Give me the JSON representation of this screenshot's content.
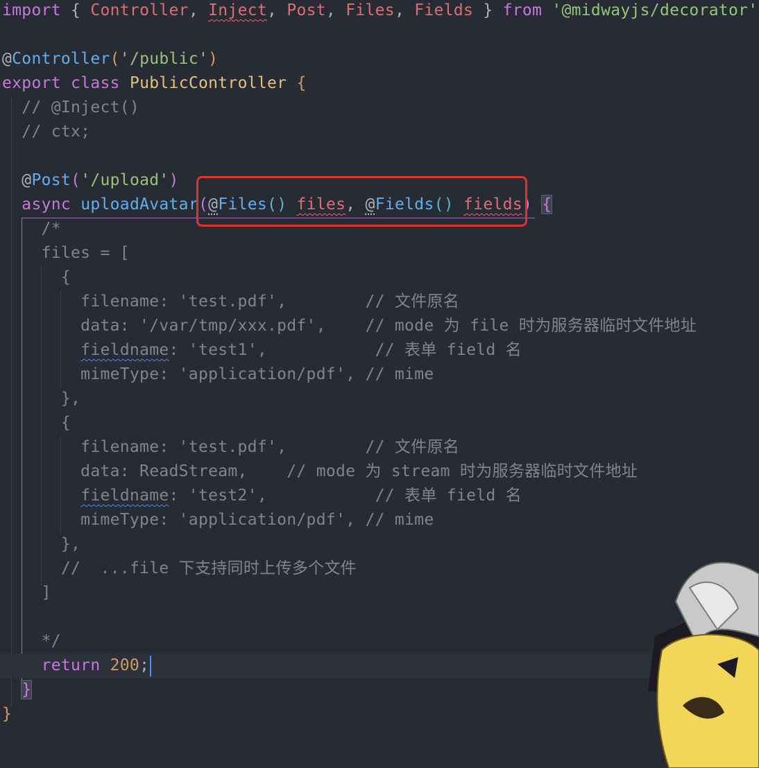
{
  "editor": {
    "lines": [
      {
        "tokens": [
          {
            "t": "import",
            "c": "kw"
          },
          {
            "t": " { ",
            "c": "plain"
          },
          {
            "t": "Controller",
            "c": "imp"
          },
          {
            "t": ", ",
            "c": "plain"
          },
          {
            "t": "Inject",
            "c": "imp squig"
          },
          {
            "t": ", ",
            "c": "plain"
          },
          {
            "t": "Post",
            "c": "imp"
          },
          {
            "t": ", ",
            "c": "plain"
          },
          {
            "t": "Files",
            "c": "imp"
          },
          {
            "t": ", ",
            "c": "plain"
          },
          {
            "t": "Fields",
            "c": "imp"
          },
          {
            "t": " } ",
            "c": "plain"
          },
          {
            "t": "from",
            "c": "kw"
          },
          {
            "t": " ",
            "c": "plain"
          },
          {
            "t": "'@midwayjs/decorator'",
            "c": "str"
          },
          {
            "t": ";",
            "c": "plain"
          }
        ]
      },
      {
        "tokens": []
      },
      {
        "tokens": [
          {
            "t": "@",
            "c": "plain"
          },
          {
            "t": "Controller",
            "c": "fn"
          },
          {
            "t": "(",
            "c": "br2"
          },
          {
            "t": "'/public'",
            "c": "str"
          },
          {
            "t": ")",
            "c": "br2"
          }
        ]
      },
      {
        "tokens": [
          {
            "t": "export",
            "c": "kw"
          },
          {
            "t": " ",
            "c": "plain"
          },
          {
            "t": "class",
            "c": "kw"
          },
          {
            "t": " ",
            "c": "plain"
          },
          {
            "t": "PublicController",
            "c": "cls"
          },
          {
            "t": " ",
            "c": "plain"
          },
          {
            "t": "{",
            "c": "br2"
          }
        ]
      },
      {
        "tokens": [
          {
            "t": "  // @Inject()",
            "c": "cm"
          }
        ]
      },
      {
        "tokens": [
          {
            "t": "  // ctx;",
            "c": "cm"
          }
        ]
      },
      {
        "tokens": []
      },
      {
        "tokens": [
          {
            "t": "  @",
            "c": "plain"
          },
          {
            "t": "Post",
            "c": "fn"
          },
          {
            "t": "(",
            "c": "br"
          },
          {
            "t": "'/upload'",
            "c": "str"
          },
          {
            "t": ")",
            "c": "br"
          }
        ]
      },
      {
        "tokens": [
          {
            "t": "  ",
            "c": "plain"
          },
          {
            "t": "async",
            "c": "kw"
          },
          {
            "t": " ",
            "c": "plain"
          },
          {
            "t": "uploadAvatar",
            "c": "fn"
          },
          {
            "t": "(",
            "c": "br"
          },
          {
            "t": "@",
            "c": "plain dots"
          },
          {
            "t": "Files",
            "c": "fn"
          },
          {
            "t": "()",
            "c": "brb"
          },
          {
            "t": " ",
            "c": "plain"
          },
          {
            "t": "files",
            "c": "param squig"
          },
          {
            "t": ", ",
            "c": "plain"
          },
          {
            "t": "@",
            "c": "plain dots"
          },
          {
            "t": "Fields",
            "c": "fn"
          },
          {
            "t": "()",
            "c": "brb"
          },
          {
            "t": " ",
            "c": "plain"
          },
          {
            "t": "fields",
            "c": "param squig"
          },
          {
            "t": ")",
            "c": "br"
          },
          {
            "t": " ",
            "c": "plain"
          },
          {
            "t": "{",
            "c": "br match"
          }
        ]
      },
      {
        "tokens": [
          {
            "t": "    /*",
            "c": "cm"
          }
        ]
      },
      {
        "tokens": [
          {
            "t": "    files = [",
            "c": "cm"
          }
        ]
      },
      {
        "tokens": [
          {
            "t": "      {",
            "c": "cm"
          }
        ]
      },
      {
        "tokens": [
          {
            "t": "        filename: 'test.pdf',        // 文件原名",
            "c": "cm"
          }
        ]
      },
      {
        "tokens": [
          {
            "t": "        data: '/var/tmp/xxx.pdf',    // mode 为 file 时为服务器临时文件地址",
            "c": "cm"
          }
        ]
      },
      {
        "tokens": [
          {
            "t": "        ",
            "c": "cm"
          },
          {
            "t": "fieldname",
            "c": "cm squig-blue"
          },
          {
            "t": ": 'test1',           // 表单 field 名",
            "c": "cm"
          }
        ]
      },
      {
        "tokens": [
          {
            "t": "        mimeType: 'application/pdf', // mime",
            "c": "cm"
          }
        ]
      },
      {
        "tokens": [
          {
            "t": "      },",
            "c": "cm"
          }
        ]
      },
      {
        "tokens": [
          {
            "t": "      {",
            "c": "cm"
          }
        ]
      },
      {
        "tokens": [
          {
            "t": "        filename: 'test.pdf',        // 文件原名",
            "c": "cm"
          }
        ]
      },
      {
        "tokens": [
          {
            "t": "        data: ReadStream,    // mode 为 stream 时为服务器临时文件地址",
            "c": "cm"
          }
        ]
      },
      {
        "tokens": [
          {
            "t": "        ",
            "c": "cm"
          },
          {
            "t": "fieldname",
            "c": "cm squig-blue"
          },
          {
            "t": ": 'test2',           // 表单 field 名",
            "c": "cm"
          }
        ]
      },
      {
        "tokens": [
          {
            "t": "        mimeType: 'application/pdf', // mime",
            "c": "cm"
          }
        ]
      },
      {
        "tokens": [
          {
            "t": "      },",
            "c": "cm"
          }
        ]
      },
      {
        "tokens": [
          {
            "t": "      //  ...file 下支持同时上传多个文件",
            "c": "cm"
          }
        ]
      },
      {
        "tokens": [
          {
            "t": "    ]",
            "c": "cm"
          }
        ]
      },
      {
        "tokens": []
      },
      {
        "tokens": [
          {
            "t": "    */",
            "c": "cm"
          }
        ]
      },
      {
        "tokens": [
          {
            "t": "    ",
            "c": "plain"
          },
          {
            "t": "return",
            "c": "kw"
          },
          {
            "t": " ",
            "c": "plain"
          },
          {
            "t": "200",
            "c": "num"
          },
          {
            "t": ";",
            "c": "plain"
          }
        ],
        "current": true
      },
      {
        "tokens": [
          {
            "t": "  ",
            "c": "plain"
          },
          {
            "t": "}",
            "c": "br match"
          }
        ]
      },
      {
        "tokens": [
          {
            "t": "}",
            "c": "br2"
          }
        ]
      }
    ]
  }
}
